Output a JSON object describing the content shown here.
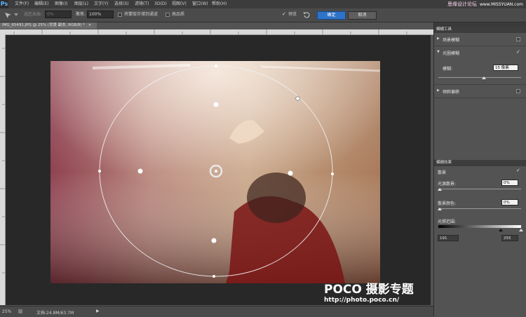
{
  "menubar": {
    "logo": "Ps",
    "items": [
      "文件(F)",
      "编辑(E)",
      "图像(I)",
      "图层(L)",
      "文字(Y)",
      "选择(S)",
      "滤镜(T)",
      "3D(D)",
      "视图(V)",
      "窗口(W)",
      "帮助(H)"
    ],
    "watermark": "思缘设计论坛",
    "watermark_site": "www.MISSYUAN.com"
  },
  "options": {
    "selection_label": "选区出血:",
    "selection_value": "0%",
    "focus_label": "聚焦:",
    "focus_value": "100%",
    "save_mask_label": "将蒙版存储到通道",
    "high_quality_label": "高品质",
    "preview_label": "预览",
    "ok_label": "确定",
    "cancel_label": "取消"
  },
  "document": {
    "tab_title": "IMG_65491.JPG @ 25% (背景 副本, RGB/8) *",
    "close_glyph": "×"
  },
  "status": {
    "zoom": "25%",
    "doc_info": "文档:24.8M/63.7M",
    "arrow": "▶"
  },
  "blur_tools": {
    "title": "模糊工具",
    "field_blur": "场景模糊",
    "iris_blur": "光圈模糊",
    "iris_checked": true,
    "blur_label": "模糊:",
    "blur_value": "15 像素",
    "blur_level": 0.55,
    "tilt_shift": "倾斜偏移"
  },
  "blur_effects": {
    "title": "模糊效果",
    "bokeh_label": "散景",
    "bokeh_checked": true,
    "light_bokeh_label": "光源散景:",
    "light_bokeh_value": "0%",
    "bokeh_color_label": "散景颜色:",
    "bokeh_color_value": "0%",
    "light_range_label": "光照范围:",
    "range_low": "191",
    "range_high": "255",
    "range_low_level": 0.75,
    "range_high_level": 1.0
  },
  "poco": {
    "brand": "POCO 摄影专题",
    "url": "http://photo.poco.cn/"
  },
  "colors": {
    "accent": "#2f73c9",
    "workspace": "#282828",
    "panel": "#535353"
  },
  "icons": [
    "ps-logo-icon",
    "move-tool-icon",
    "check-icon",
    "undo-icon",
    "triangle-right-icon",
    "triangle-down-icon"
  ]
}
